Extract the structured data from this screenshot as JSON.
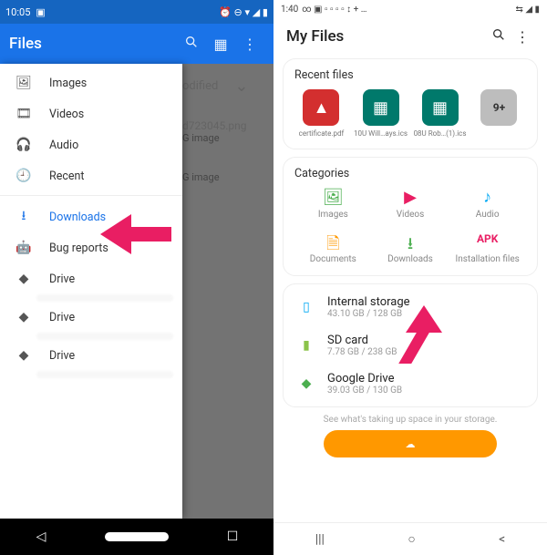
{
  "left": {
    "status": {
      "time": "10:05",
      "icons": "⏰ ⊖ ▾ ◢ ▮"
    },
    "appbar": {
      "title": "Files"
    },
    "bg": {
      "sort_label": "odified",
      "file1_name": "d723045.png",
      "file1_type": "G image",
      "file2_type": "G image"
    },
    "drawer": {
      "items": [
        {
          "icon": "image-icon",
          "label": "Images"
        },
        {
          "icon": "video-icon",
          "label": "Videos"
        },
        {
          "icon": "audio-icon",
          "label": "Audio"
        },
        {
          "icon": "recent-icon",
          "label": "Recent"
        }
      ],
      "items2": [
        {
          "icon": "download-icon",
          "label": "Downloads",
          "active": true
        },
        {
          "icon": "bug-icon",
          "label": "Bug reports"
        },
        {
          "icon": "drive-icon",
          "label": "Drive"
        },
        {
          "icon": "drive-icon",
          "label": "Drive"
        },
        {
          "icon": "drive-icon",
          "label": "Drive"
        }
      ]
    }
  },
  "right": {
    "status": {
      "time": "1:40",
      "left_icons": "∞ ▣ ▫ ▫ ▫ ▫ ↕ + …",
      "right_icons": "⇆ ◢ ▮"
    },
    "header": {
      "title": "My Files"
    },
    "recent": {
      "title": "Recent files",
      "items": [
        {
          "kind": "pdf",
          "label": "certificate.pdf"
        },
        {
          "kind": "ics",
          "label": "10U Will…ays.ics"
        },
        {
          "kind": "ics",
          "label": "08U Rob…(1).ics"
        },
        {
          "kind": "more",
          "label": "9+"
        }
      ]
    },
    "categories": {
      "title": "Categories",
      "items": [
        {
          "label": "Images"
        },
        {
          "label": "Videos"
        },
        {
          "label": "Audio"
        },
        {
          "label": "Documents"
        },
        {
          "label": "Downloads"
        },
        {
          "label": "Installation files"
        }
      ],
      "apk_text": "APK"
    },
    "storage": [
      {
        "title": "Internal storage",
        "sub": "43.10 GB / 128 GB",
        "color": "#03a9f4"
      },
      {
        "title": "SD card",
        "sub": "7.78 GB / 238 GB",
        "color": "#8bc34a"
      },
      {
        "title": "Google Drive",
        "sub": "39.03 GB / 130 GB",
        "color": "#4caf50"
      }
    ],
    "tip": "See what's taking up space in your storage."
  }
}
